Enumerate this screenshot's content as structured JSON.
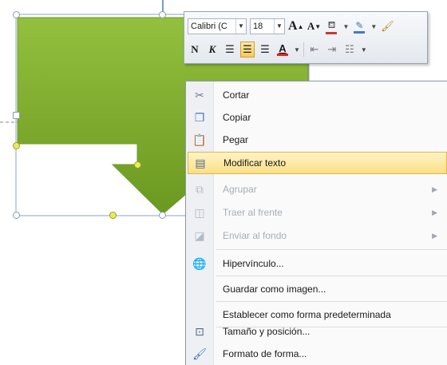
{
  "mini_toolbar": {
    "font_name": "Calibri (C",
    "font_size": "18",
    "grow_font": "A",
    "shrink_font": "A",
    "bold": "N",
    "italic": "K",
    "font_color_letter": "A"
  },
  "context_menu": {
    "items": [
      {
        "label": "Cortar",
        "icon": "scissors-icon",
        "enabled": true
      },
      {
        "label": "Copiar",
        "icon": "copy-icon",
        "enabled": true
      },
      {
        "label": "Pegar",
        "icon": "clipboard-paste-icon",
        "enabled": true
      },
      {
        "label": "Modificar texto",
        "icon": "edit-text-icon",
        "enabled": true,
        "highlighted": true
      },
      {
        "label": "Agrupar",
        "icon": "group-icon",
        "enabled": false,
        "submenu": true
      },
      {
        "label": "Traer al frente",
        "icon": "bring-to-front-icon",
        "enabled": false,
        "submenu": true
      },
      {
        "label": "Enviar al fondo",
        "icon": "send-to-back-icon",
        "enabled": false,
        "submenu": true
      },
      {
        "label": "Hipervínculo...",
        "icon": "hyperlink-globe-icon",
        "enabled": true
      },
      {
        "label": "Guardar como imagen...",
        "icon": "",
        "enabled": true
      },
      {
        "label": "Establecer como forma predeterminada",
        "icon": "",
        "enabled": true
      },
      {
        "label": "Tamaño y posición...",
        "icon": "size-position-icon",
        "enabled": true
      },
      {
        "label": "Formato de forma...",
        "icon": "format-shape-icon",
        "enabled": true
      }
    ],
    "submenu_glyph": "▶"
  },
  "colors": {
    "shape_fill_top": "#8dbb3c",
    "shape_fill_bottom": "#6e9a22",
    "highlight": "#fcdf86",
    "font_color_bar": "#e02020",
    "highlight_color_bar": "#f2e100"
  }
}
